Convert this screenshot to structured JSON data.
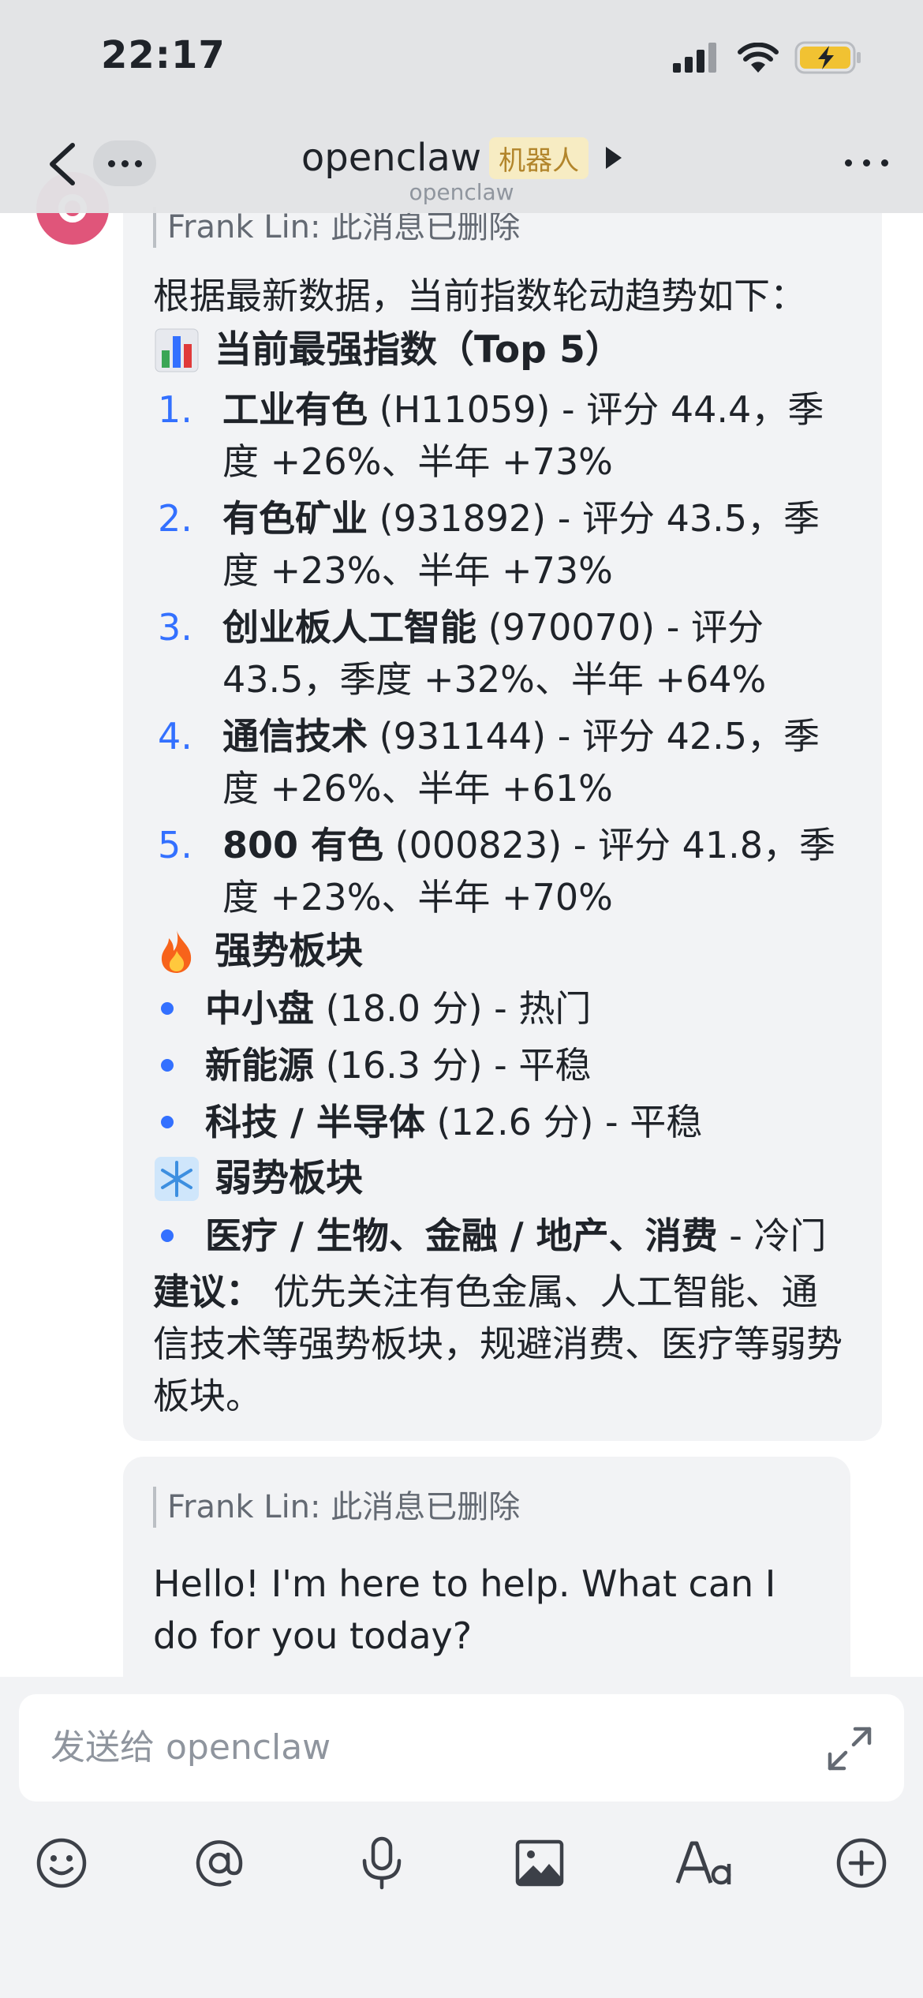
{
  "status_bar": {
    "time": "22:17"
  },
  "nav": {
    "title": "openclaw",
    "badge": "机器人",
    "subtitle": "openclaw"
  },
  "messages": [
    {
      "quote": "Frank Lin: 此消息已删除",
      "intro": "根据最新数据，当前指数轮动趋势如下：",
      "section_top": {
        "icon": "bar-chart-emoji",
        "title": "当前最强指数（Top 5）"
      },
      "top5": [
        {
          "num": "1.",
          "name": "工业有色",
          "detail": " (H11059) - 评分 44.4，季度 +26%、半年 +73%"
        },
        {
          "num": "2.",
          "name": "有色矿业",
          "detail": " (931892) - 评分 43.5，季度 +23%、半年 +73%"
        },
        {
          "num": "3.",
          "name": "创业板人工智能",
          "detail": " (970070) - 评分 43.5，季度 +32%、半年 +64%"
        },
        {
          "num": "4.",
          "name": "通信技术",
          "detail": " (931144) - 评分 42.5，季度 +26%、半年 +61%"
        },
        {
          "num": "5.",
          "name": "800 有色",
          "detail": " (000823) - 评分 41.8，季度 +23%、半年 +70%"
        }
      ],
      "section_strong": {
        "icon": "fire-emoji",
        "title": "强势板块"
      },
      "strong": [
        {
          "name": "中小盘",
          "detail": " (18.0 分) - 热门"
        },
        {
          "name": "新能源",
          "detail": " (16.3 分) - 平稳"
        },
        {
          "name": "科技 / 半导体",
          "detail": " (12.6 分) - 平稳"
        }
      ],
      "section_weak": {
        "icon": "snowflake-emoji",
        "title": "弱势板块"
      },
      "weak": [
        {
          "name": "医疗 / 生物、金融 / 地产、消费",
          "detail": " - 冷门"
        }
      ],
      "suggest_label": "建议：",
      "suggest_text": " 优先关注有色金属、人工智能、通信技术等强势板块，规避消费、医疗等弱势板块。"
    },
    {
      "quote": "Frank Lin: 此消息已删除",
      "text": "Hello! I'm here to help. What can I do for you today?"
    }
  ],
  "composer": {
    "placeholder": "发送给 openclaw"
  },
  "colors": {
    "accent": "#3370ff",
    "bubble_bg": "#f2f3f5",
    "badge_bg": "#f7ecc3",
    "badge_text": "#b2852b",
    "avatar": "#e0557a"
  }
}
